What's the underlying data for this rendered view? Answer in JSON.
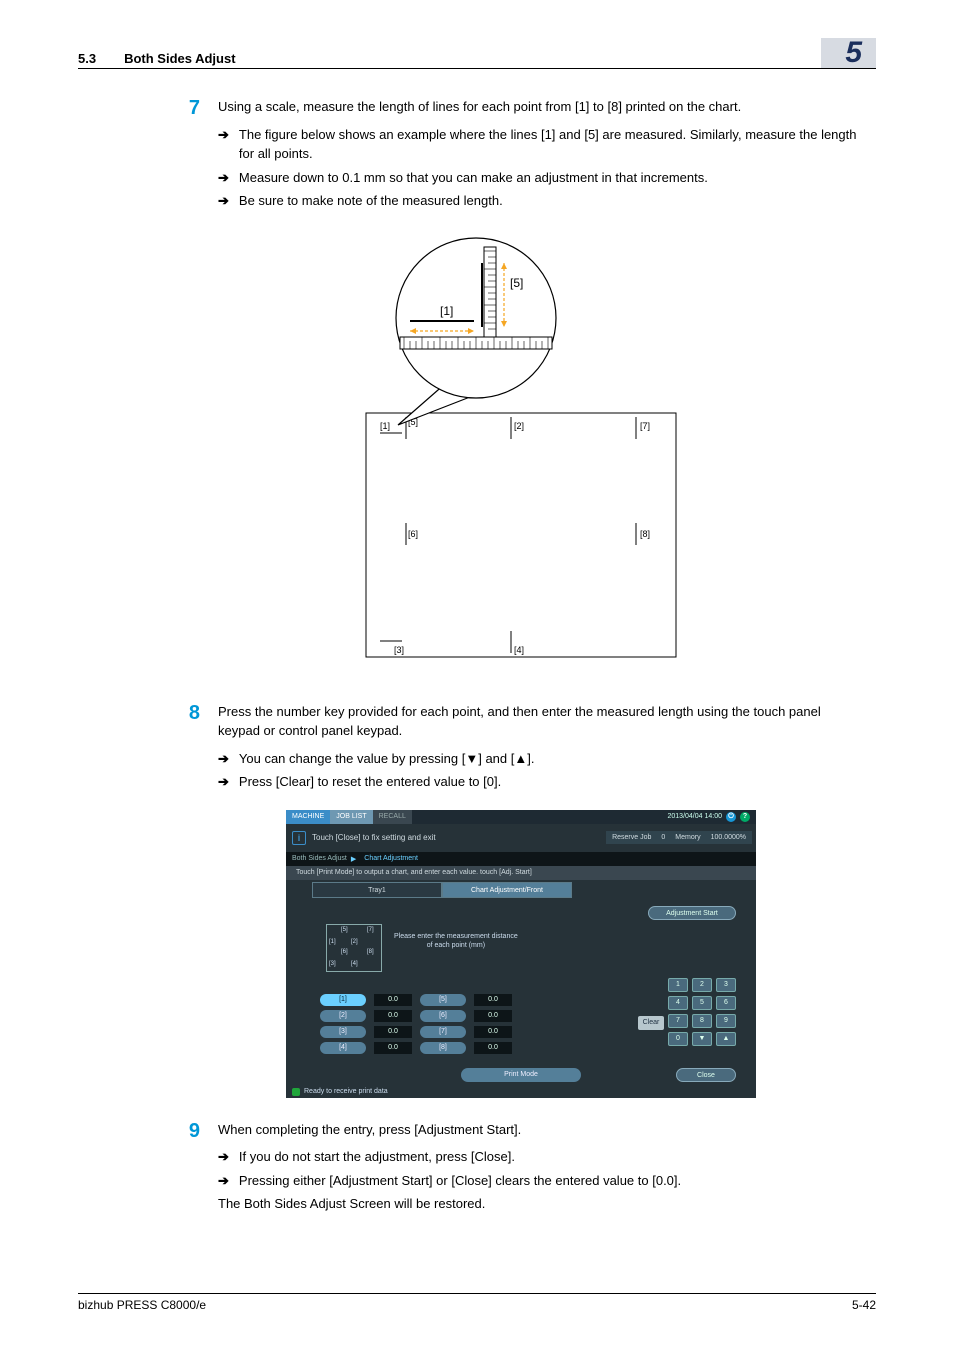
{
  "header": {
    "section_number": "5.3",
    "section_title": "Both Sides Adjust",
    "chapter": "5"
  },
  "steps": {
    "s7": {
      "num": "7",
      "text": "Using a scale, measure the length of lines for each point from [1] to [8] printed on the chart.",
      "bullets": [
        "The figure below shows an example where the lines [1] and [5] are measured. Similarly, measure the length for all points.",
        "Measure down to 0.1 mm so that you can make an adjustment in that increments.",
        "Be sure to make note of the measured length."
      ]
    },
    "s8": {
      "num": "8",
      "text": "Press the number key provided for each point, and then enter the measured length using the touch panel keypad or control panel keypad.",
      "bullets": [
        "You can change the value by pressing [▼] and [▲].",
        "Press [Clear] to reset the entered value to [0]."
      ]
    },
    "s9": {
      "num": "9",
      "text": "When completing the entry, press [Adjustment Start].",
      "bullets": [
        "If you do not start the adjustment, press [Close].",
        "Pressing either [Adjustment Start] or [Close] clears the entered value to [0.0]."
      ],
      "tail": "The Both Sides Adjust Screen will be restored."
    }
  },
  "diagram": {
    "labels": {
      "b1": "[1]",
      "b2": "[2]",
      "b3": "[3]",
      "b4": "[4]",
      "b5": "[5]",
      "b6": "[6]",
      "b7": "[7]",
      "b8": "[8]"
    },
    "mag": {
      "l1": "[1]",
      "l5": "[5]"
    }
  },
  "panel": {
    "tabs": {
      "machine": "MACHINE",
      "joblist": "JOB LIST",
      "recall": "RECALL"
    },
    "datetime": "2013/04/04  14:00",
    "info_msg": "Touch [Close] to fix setting and exit",
    "memory": {
      "reserve": "Reserve Job",
      "rcount": "0",
      "mem": "Memory",
      "mval": "100.0000%"
    },
    "breadcrumb": {
      "a": "Both Sides Adjust",
      "arrow": "▶",
      "b": "Chart Adjustment"
    },
    "tip": "Touch [Print Mode] to output a chart, and enter each value. touch [Adj. Start]",
    "tray_label": "Tray1",
    "chart_tab": "Chart Adjustment/Front",
    "adj_start": "Adjustment Start",
    "help1": "Please enter the measurement distance",
    "help2": "of each point (mm)",
    "vals": {
      "b1": "[1]",
      "b2": "[2]",
      "b3": "[3]",
      "b4": "[4]",
      "b5": "[5]",
      "b6": "[6]",
      "b7": "[7]",
      "b8": "[8]",
      "zero": "0.0"
    },
    "keys": {
      "k1": "1",
      "k2": "2",
      "k3": "3",
      "k4": "4",
      "k5": "5",
      "k6": "6",
      "k7": "7",
      "k8": "8",
      "k9": "9",
      "k0": "0",
      "kd": "▼",
      "ku": "▲"
    },
    "clear": "Clear",
    "print_mode": "Print Mode",
    "close": "Close",
    "status": "Ready to receive print data",
    "mini": {
      "m1": "[1]",
      "m2": "[2]",
      "m3": "[3]",
      "m4": "[4]",
      "m5": "[5]",
      "m6": "[6]",
      "m7": "[7]",
      "m8": "[8]"
    }
  },
  "footer": {
    "left": "bizhub PRESS C8000/e",
    "right": "5-42"
  }
}
